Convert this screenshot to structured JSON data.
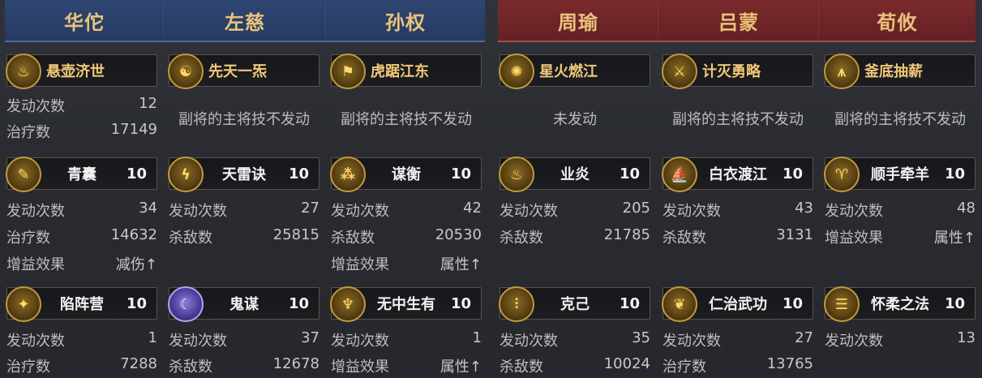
{
  "teams": {
    "blue": {
      "color": "#2f4673"
    },
    "red": {
      "color": "#7a2a2c"
    }
  },
  "headers": [
    "华佗",
    "左慈",
    "孙权",
    "周瑜",
    "吕蒙",
    "荀攸"
  ],
  "columns": [
    {
      "main_skill": {
        "name": "悬壶济世",
        "icon": "gourd-icon"
      },
      "main_rows": [
        {
          "label": "发动次数",
          "value": "12"
        },
        {
          "label": "治疗数",
          "value": "17149"
        }
      ],
      "main_note": "",
      "skill2": {
        "name": "青囊",
        "level": "10",
        "icon": "scroll-icon"
      },
      "rows2": [
        {
          "label": "发动次数",
          "value": "34"
        },
        {
          "label": "治疗数",
          "value": "14632"
        },
        {
          "label": "增益效果",
          "value": "减伤↑"
        }
      ],
      "skill3": {
        "name": "陷阵营",
        "level": "10",
        "icon": "charge-icon"
      },
      "rows3": [
        {
          "label": "发动次数",
          "value": "1"
        },
        {
          "label": "治疗数",
          "value": "7288"
        }
      ]
    },
    {
      "main_skill": {
        "name": "先天一炁",
        "icon": "meditation-icon"
      },
      "main_rows": [],
      "main_note": "副将的主将技不发动",
      "skill2": {
        "name": "天雷诀",
        "level": "10",
        "icon": "lightning-icon"
      },
      "rows2": [
        {
          "label": "发动次数",
          "value": "27"
        },
        {
          "label": "杀敌数",
          "value": "25815"
        }
      ],
      "skill3": {
        "name": "鬼谋",
        "level": "10",
        "icon": "ghost-icon"
      },
      "rows3": [
        {
          "label": "发动次数",
          "value": "37"
        },
        {
          "label": "杀敌数",
          "value": "12678"
        }
      ]
    },
    {
      "main_skill": {
        "name": "虎踞江东",
        "icon": "banner-icon"
      },
      "main_rows": [],
      "main_note": "副将的主将技不发动",
      "skill2": {
        "name": "谋衡",
        "level": "10",
        "icon": "orbs-icon"
      },
      "rows2": [
        {
          "label": "发动次数",
          "value": "42"
        },
        {
          "label": "杀敌数",
          "value": "20530"
        },
        {
          "label": "增益效果",
          "value": "属性↑"
        }
      ],
      "skill3": {
        "name": "无中生有",
        "level": "10",
        "icon": "sage-icon"
      },
      "rows3": [
        {
          "label": "发动次数",
          "value": "1"
        },
        {
          "label": "增益效果",
          "value": "属性↑"
        }
      ]
    },
    {
      "main_skill": {
        "name": "星火燃江",
        "icon": "fire-icon"
      },
      "main_rows": [],
      "main_note": "未发动",
      "skill2": {
        "name": "业炎",
        "level": "10",
        "icon": "flame-icon"
      },
      "rows2": [
        {
          "label": "发动次数",
          "value": "205"
        },
        {
          "label": "杀敌数",
          "value": "21785"
        }
      ],
      "skill3": {
        "name": "克己",
        "level": "10",
        "icon": "spikes-icon"
      },
      "rows3": [
        {
          "label": "发动次数",
          "value": "35"
        },
        {
          "label": "杀敌数",
          "value": "10024"
        }
      ]
    },
    {
      "main_skill": {
        "name": "计灭勇略",
        "icon": "sword-icon"
      },
      "main_rows": [],
      "main_note": "副将的主将技不发动",
      "skill2": {
        "name": "白衣渡江",
        "level": "10",
        "icon": "boat-icon"
      },
      "rows2": [
        {
          "label": "发动次数",
          "value": "43"
        },
        {
          "label": "杀敌数",
          "value": "3131"
        }
      ],
      "skill3": {
        "name": "仁治武功",
        "level": "10",
        "icon": "dragon-icon"
      },
      "rows3": [
        {
          "label": "发动次数",
          "value": "27"
        },
        {
          "label": "治疗数",
          "value": "13765"
        }
      ]
    },
    {
      "main_skill": {
        "name": "釜底抽薪",
        "icon": "tripod-icon"
      },
      "main_rows": [],
      "main_note": "副将的主将技不发动",
      "skill2": {
        "name": "顺手牵羊",
        "level": "10",
        "icon": "goat-icon"
      },
      "rows2": [
        {
          "label": "发动次数",
          "value": "48"
        },
        {
          "label": "增益效果",
          "value": "属性↑"
        }
      ],
      "skill3": {
        "name": "怀柔之法",
        "level": "10",
        "icon": "book-icon"
      },
      "rows3": [
        {
          "label": "发动次数",
          "value": "13"
        }
      ]
    }
  ]
}
